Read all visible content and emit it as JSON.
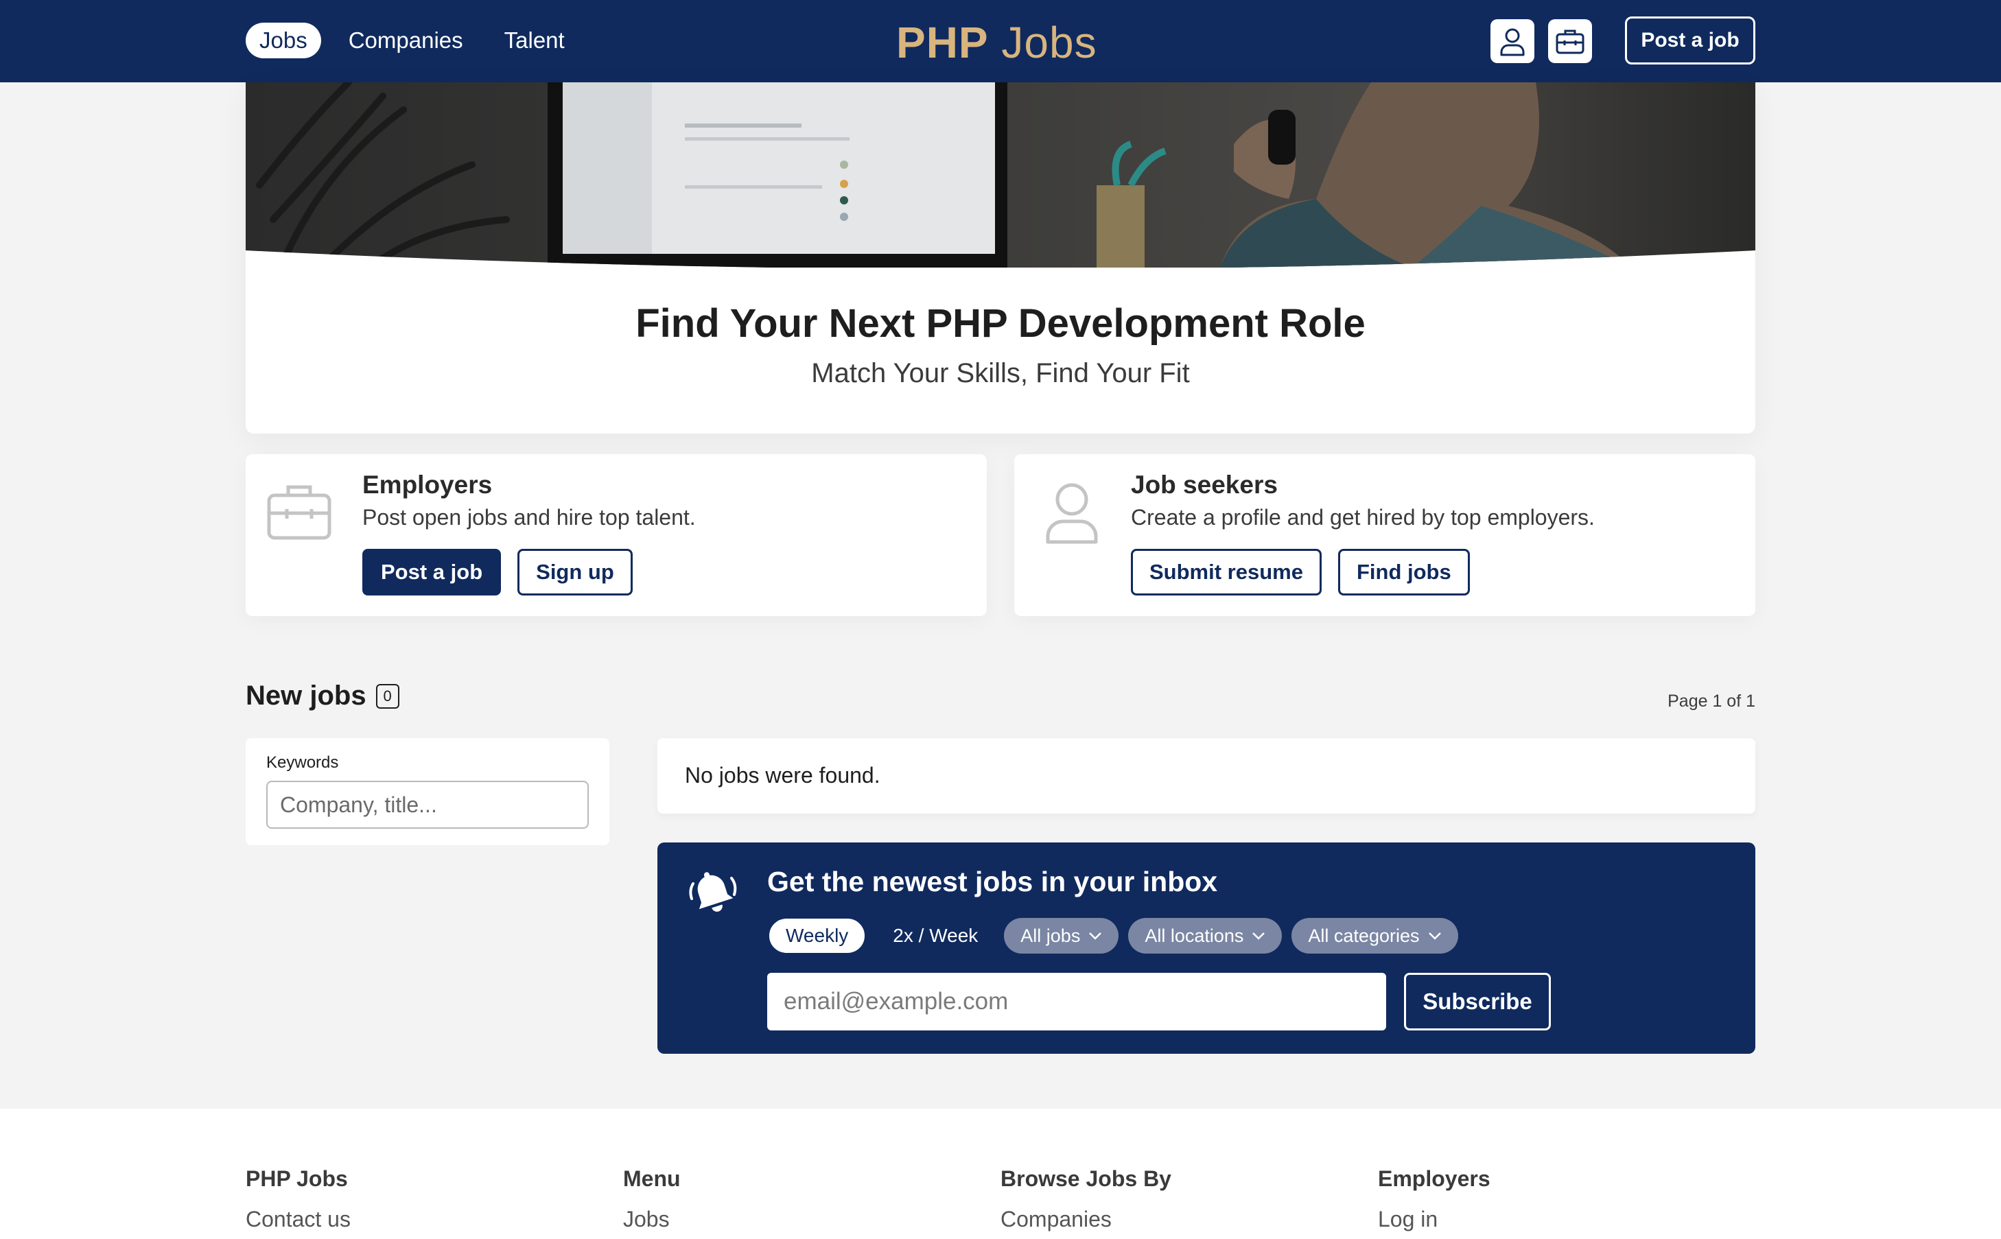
{
  "header": {
    "nav": [
      {
        "label": "Jobs",
        "active": true
      },
      {
        "label": "Companies",
        "active": false
      },
      {
        "label": "Talent",
        "active": false
      }
    ],
    "logo_php": "PHP",
    "logo_jobs": "Jobs",
    "post_label": "Post a job",
    "accent": "#102a5e",
    "logo_color": "#d8b57e"
  },
  "hero": {
    "title": "Find Your Next PHP Development Role",
    "subtitle": "Match Your Skills, Find Your Fit"
  },
  "employers": {
    "title": "Employers",
    "desc": "Post open jobs and hire top talent.",
    "primary_label": "Post a job",
    "secondary_label": "Sign up"
  },
  "seekers": {
    "title": "Job seekers",
    "desc": "Create a profile and get hired by top employers.",
    "primary_label": "Submit resume",
    "secondary_label": "Find jobs"
  },
  "jobs": {
    "title": "New jobs",
    "count": "0",
    "page_info": "Page 1 of 1",
    "empty_text": "No jobs were found."
  },
  "filter": {
    "label": "Keywords",
    "placeholder": "Company, title..."
  },
  "newsletter": {
    "title": "Get the newest jobs in your inbox",
    "freq_weekly": "Weekly",
    "freq_2x": "2x / Week",
    "pill_jobs": "All jobs",
    "pill_locations": "All locations",
    "pill_categories": "All categories",
    "email_placeholder": "email@example.com",
    "subscribe_label": "Subscribe"
  },
  "footer": {
    "cols": [
      {
        "head": "PHP Jobs",
        "link": "Contact us"
      },
      {
        "head": "Menu",
        "link": "Jobs"
      },
      {
        "head": "Browse Jobs By",
        "link": "Companies"
      },
      {
        "head": "Employers",
        "link": "Log in"
      }
    ]
  }
}
